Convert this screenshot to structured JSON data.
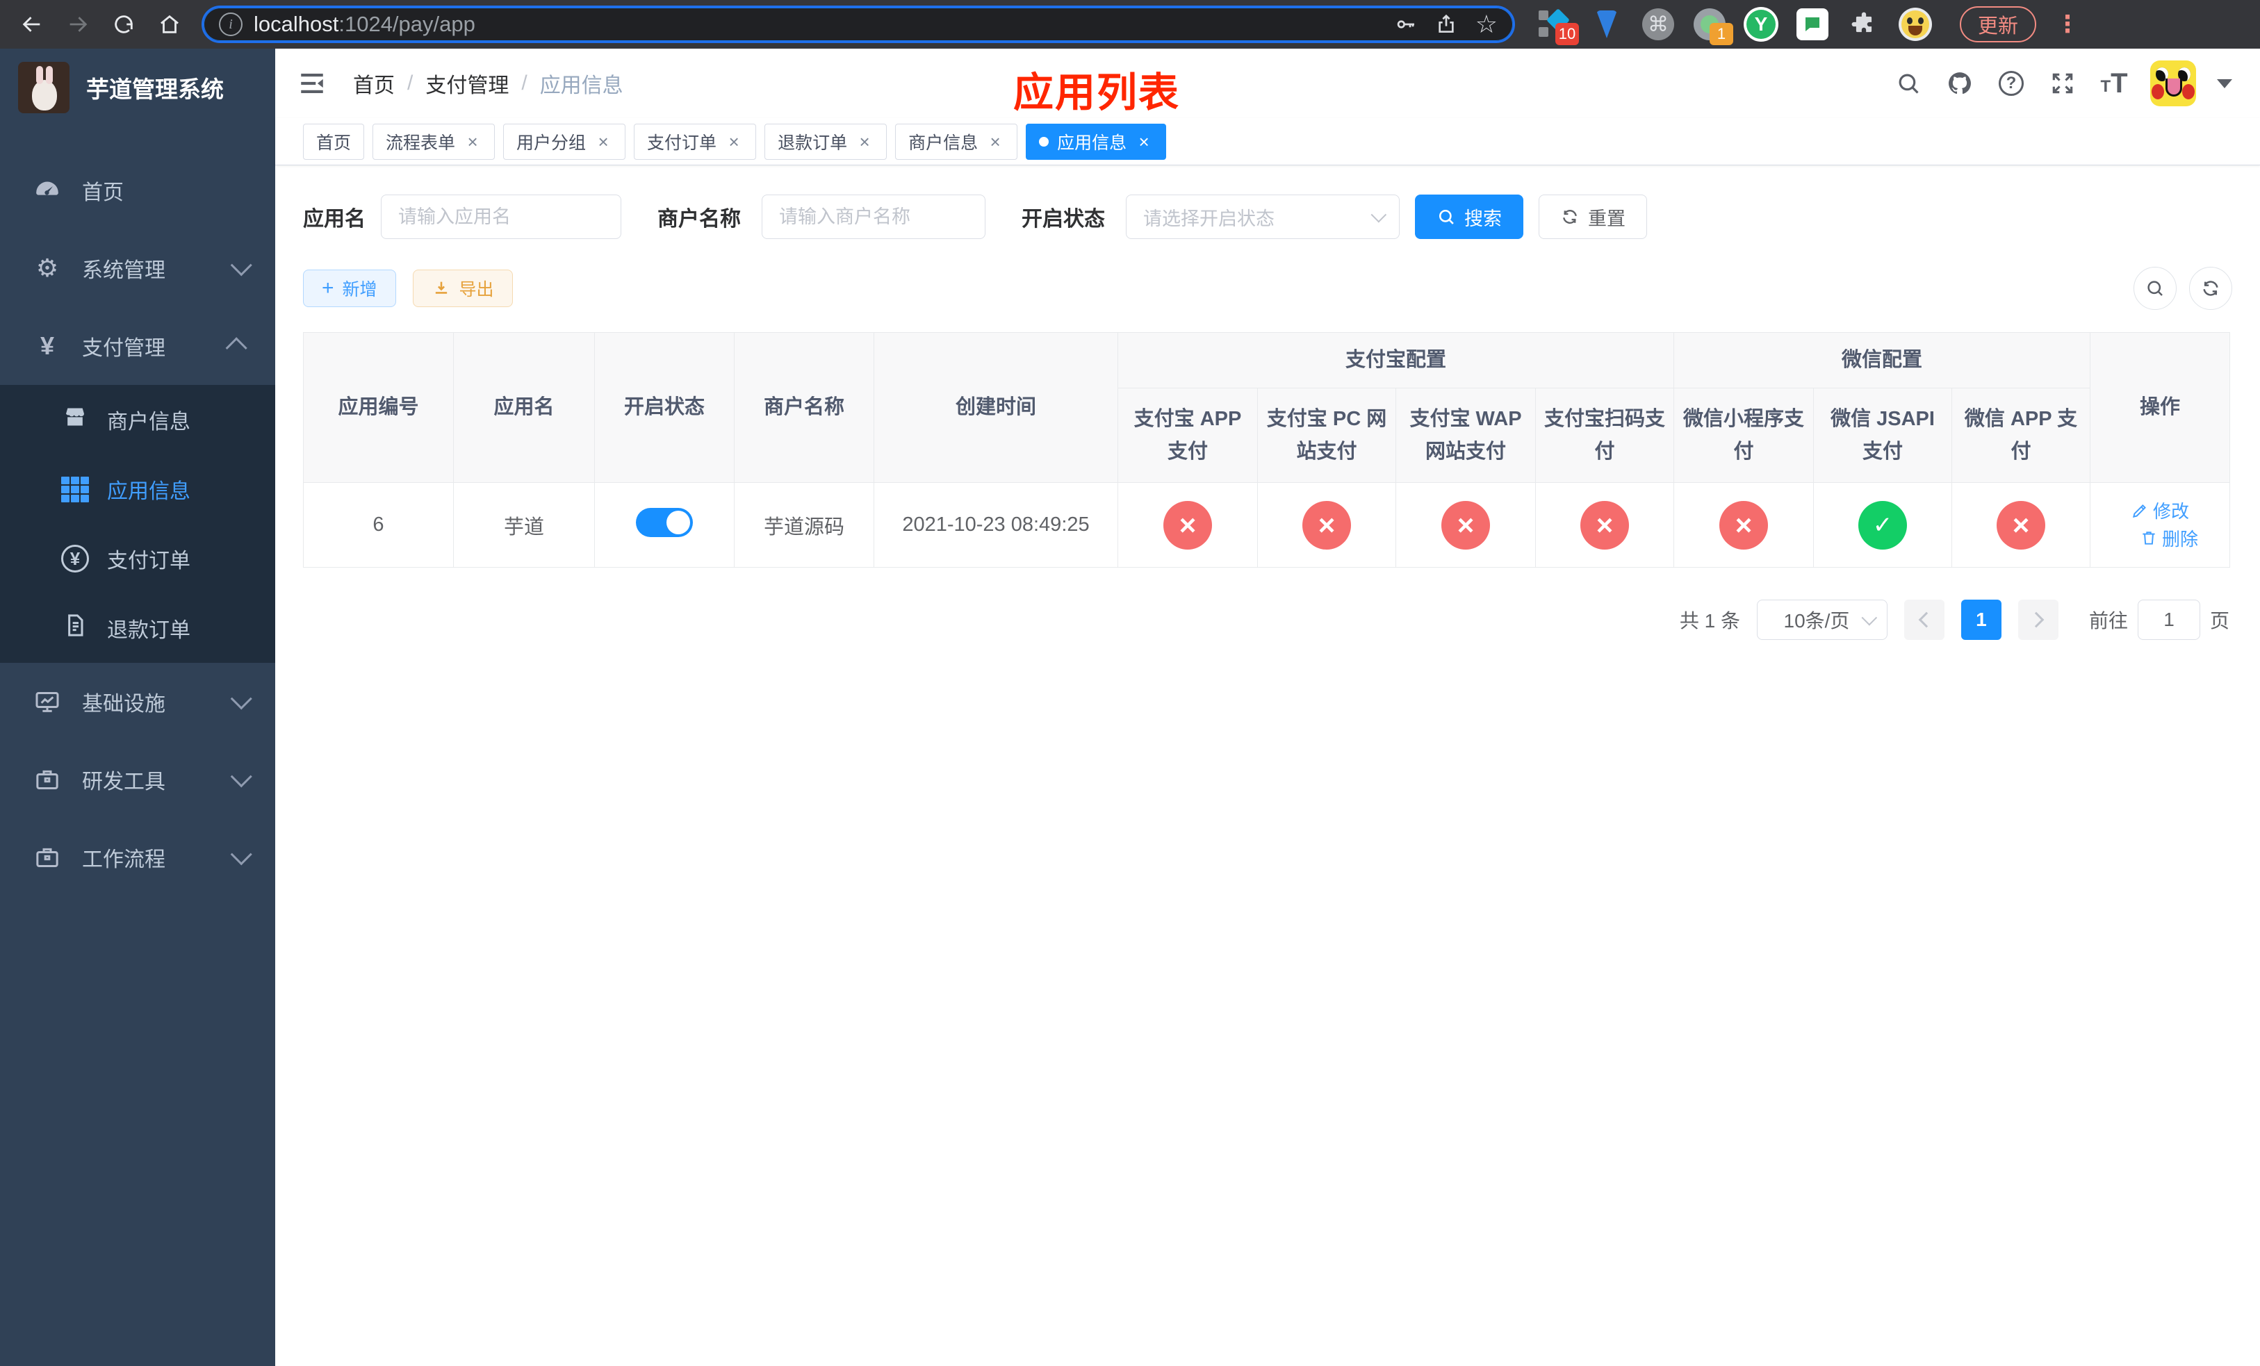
{
  "browser": {
    "url_host": "localhost",
    "url_path": ":1024/pay/app",
    "update_button": "更新",
    "badges": {
      "pin_count": "10",
      "recorder_count": "1"
    }
  },
  "sidebar": {
    "title": "芋道管理系统",
    "menu": {
      "home": "首页",
      "system": "系统管理",
      "payment": "支付管理",
      "merchant_info": "商户信息",
      "app_info": "应用信息",
      "pay_order": "支付订单",
      "refund_order": "退款订单",
      "infrastructure": "基础设施",
      "dev_tools": "研发工具",
      "workflow": "工作流程"
    }
  },
  "header": {
    "breadcrumb": [
      "首页",
      "支付管理",
      "应用信息"
    ],
    "annotation": "应用列表"
  },
  "tabs": [
    {
      "label": "首页",
      "closable": false,
      "active": false
    },
    {
      "label": "流程表单",
      "closable": true,
      "active": false
    },
    {
      "label": "用户分组",
      "closable": true,
      "active": false
    },
    {
      "label": "支付订单",
      "closable": true,
      "active": false
    },
    {
      "label": "退款订单",
      "closable": true,
      "active": false
    },
    {
      "label": "商户信息",
      "closable": true,
      "active": false
    },
    {
      "label": "应用信息",
      "closable": true,
      "active": true
    }
  ],
  "filters": {
    "app_name_label": "应用名",
    "app_name_placeholder": "请输入应用名",
    "merchant_label": "商户名称",
    "merchant_placeholder": "请输入商户名称",
    "status_label": "开启状态",
    "status_placeholder": "请选择开启状态",
    "search_button": "搜索",
    "reset_button": "重置"
  },
  "toolbar": {
    "add_button": "新增",
    "export_button": "导出"
  },
  "table": {
    "group_headers": {
      "alipay": "支付宝配置",
      "wechat": "微信配置"
    },
    "columns": {
      "id": "应用编号",
      "name": "应用名",
      "status": "开启状态",
      "merchant": "商户名称",
      "created": "创建时间",
      "alipay_app": "支付宝 APP 支付",
      "alipay_pc": "支付宝 PC 网站支付",
      "alipay_wap": "支付宝 WAP 网站支付",
      "alipay_qr": "支付宝扫码支付",
      "wechat_lite": "微信小程序支付",
      "wechat_jsapi": "微信 JSAPI 支付",
      "wechat_app": "微信 APP 支付",
      "actions": "操作"
    },
    "rows": [
      {
        "id": "6",
        "name": "芋道",
        "enabled": true,
        "merchant": "芋道源码",
        "created": "2021-10-23 08:49:25",
        "statuses": {
          "alipay_app": "fail",
          "alipay_pc": "fail",
          "alipay_wap": "fail",
          "alipay_qr": "fail",
          "wechat_lite": "fail",
          "wechat_jsapi": "success",
          "wechat_app": "fail"
        },
        "edit_label": "修改",
        "delete_label": "删除"
      }
    ]
  },
  "pagination": {
    "total_text": "共 1 条",
    "page_size": "10条/页",
    "current_page": "1",
    "goto_label": "前往",
    "goto_value": "1",
    "page_unit": "页"
  },
  "colors": {
    "primary": "#1890ff",
    "success": "#13ce66",
    "danger": "#f56c6c",
    "warning": "#e6a23c",
    "annotation": "#ff2600",
    "sidebar_bg": "#304156",
    "submenu_bg": "#1f2d3d"
  }
}
